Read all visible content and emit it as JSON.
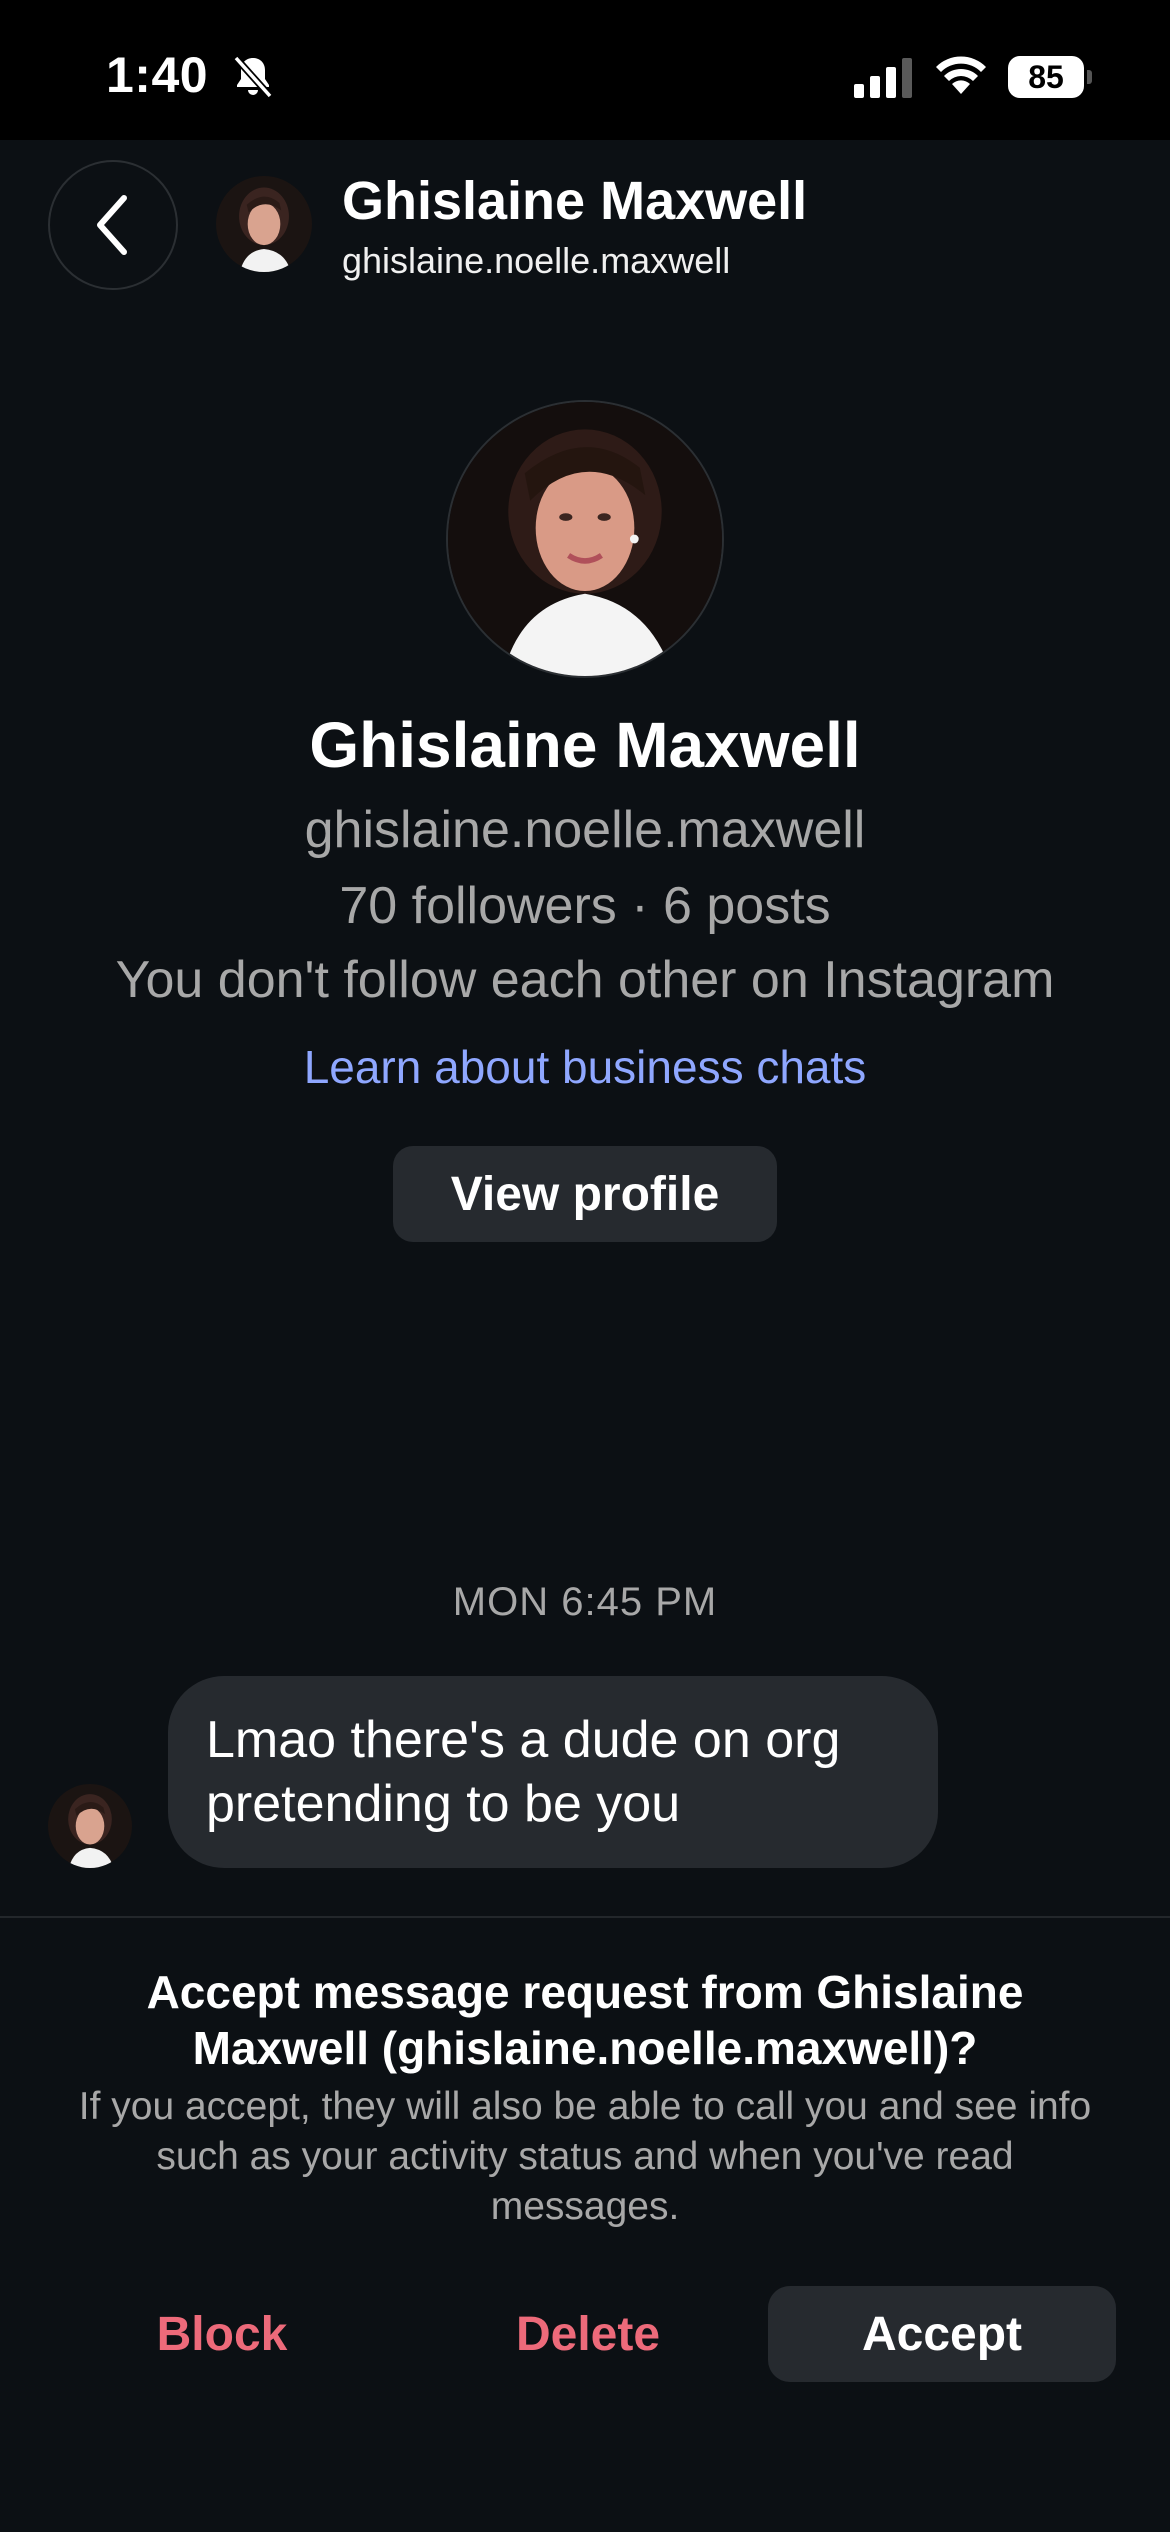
{
  "status_bar": {
    "time": "1:40",
    "battery": "85",
    "icons": [
      "bell-slash-icon",
      "signal-icon",
      "wifi-icon",
      "battery-icon"
    ]
  },
  "header": {
    "back_icon": "chevron-left-icon",
    "name": "Ghislaine Maxwell",
    "username": "ghislaine.noelle.maxwell"
  },
  "profile": {
    "name": "Ghislaine Maxwell",
    "username": "ghislaine.noelle.maxwell",
    "stats": "70 followers · 6 posts",
    "follow_status": "You don't follow each other on Instagram",
    "business_link": "Learn about business chats",
    "view_profile_label": "View profile"
  },
  "conversation": {
    "timestamp": "MON 6:45 PM",
    "messages": [
      {
        "text": "Lmao there's a dude on org pretending to be you"
      }
    ]
  },
  "request": {
    "title": "Accept message request from Ghislaine Maxwell (ghislaine.noelle.maxwell)?",
    "body": "If you accept, they will also be able to call you and see info such as your activity status and when you've read messages.",
    "block_label": "Block",
    "delete_label": "Delete",
    "accept_label": "Accept"
  },
  "colors": {
    "background": "#0c1014",
    "bubble": "#262a2f",
    "link": "#8fa7ff",
    "danger": "#ed6a7a",
    "secondary_text": "#a8a8a8"
  }
}
